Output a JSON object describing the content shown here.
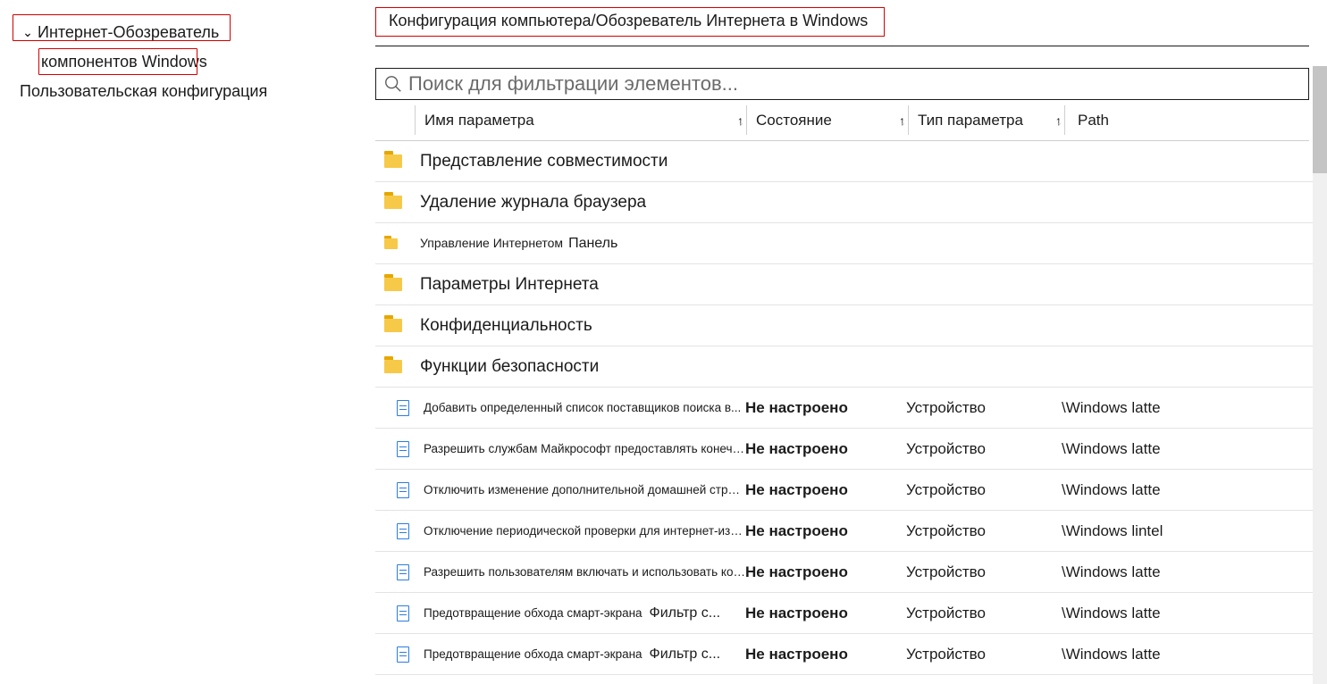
{
  "sidebar": {
    "items": [
      {
        "label": "Интернет-Обозреватель",
        "expanded": true
      },
      {
        "label": "компонентов Windows"
      },
      {
        "label": "Пользовательская конфигурация"
      }
    ]
  },
  "breadcrumb": "Конфигурация компьютера/Обозреватель Интернета в Windows",
  "search": {
    "placeholder": "Поиск для фильтрации элементов..."
  },
  "columns": {
    "name": "Имя параметра",
    "state": "Состояние",
    "type": "Тип параметра",
    "path": "Path"
  },
  "folders": [
    {
      "label": "Представление совместимости"
    },
    {
      "label": "Удаление журнала браузера"
    },
    {
      "label": "Управление Интернетом",
      "extra": "Панель",
      "small": true
    },
    {
      "label": "Параметры Интернета"
    },
    {
      "label": "Конфиденциальность"
    },
    {
      "label": "Функции безопасности"
    }
  ],
  "settings": [
    {
      "name": "Добавить определенный список поставщиков поиска в...",
      "state": "Не настроено",
      "type": "Устройство",
      "path": "\\Windows latte"
    },
    {
      "name": "Разрешить службам Майкрософт предоставлять конечный",
      "state": "Не настроено",
      "type": "Устройство",
      "path": "\\Windows latte"
    },
    {
      "name": "Отключить изменение дополнительной домашней страницы...",
      "state": "Не настроено",
      "type": "Устройство",
      "path": "\\Windows latte"
    },
    {
      "name": "Отключение периодической проверки для интернет-изгнания",
      "state": "Не настроено",
      "type": "Устройство",
      "path": "\\Windows lintel"
    },
    {
      "name": "Разрешить пользователям включать и использовать корпоративный МО...",
      "state": "Не настроено",
      "type": "Устройство",
      "path": "\\Windows latte"
    },
    {
      "name": "Предотвращение обхода смарт-экрана",
      "extra": "Фильтр с...",
      "state": "Не настроено",
      "type": "Устройство",
      "path": "\\Windows latte"
    },
    {
      "name": "Предотвращение обхода смарт-экрана",
      "extra": "Фильтр с...",
      "state": "Не настроено",
      "type": "Устройство",
      "path": "\\Windows latte"
    }
  ]
}
